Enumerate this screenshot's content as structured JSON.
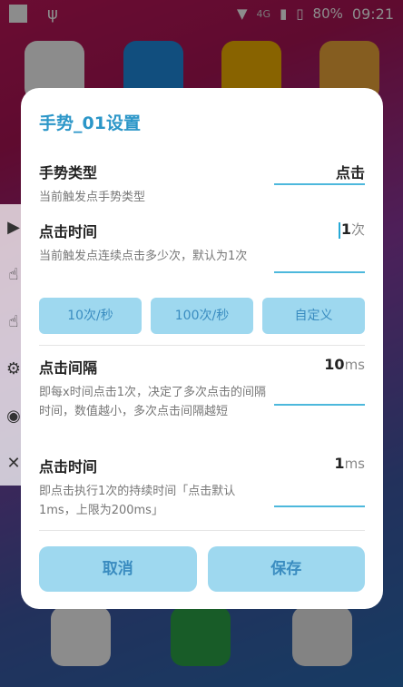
{
  "status": {
    "network": "4G",
    "battery": "80%",
    "time": "09:21"
  },
  "dialog": {
    "title": "手势_01设置",
    "gesture_type": {
      "label": "手势类型",
      "desc": "当前触发点手势类型",
      "value": "点击"
    },
    "click_count": {
      "label": "点击时间",
      "desc": "当前触发点连续点击多少次，默认为1次",
      "value": "1",
      "unit": "次"
    },
    "presets": [
      "10次/秒",
      "100次/秒",
      "自定义"
    ],
    "interval": {
      "label": "点击间隔",
      "desc": "即每x时间点击1次，决定了多次点击的间隔时间，数值越小，多次点击间隔越短",
      "value": "10",
      "unit": "ms"
    },
    "duration": {
      "label": "点击时间",
      "desc": "即点击执行1次的持续时间「点击默认1ms，上限为200ms」",
      "value": "1",
      "unit": "ms"
    },
    "cancel_label": "取消",
    "save_label": "保存"
  },
  "colors": {
    "accent": "#2b96c8",
    "button_bg": "#9ed8ef",
    "underline": "#4db8dc"
  }
}
